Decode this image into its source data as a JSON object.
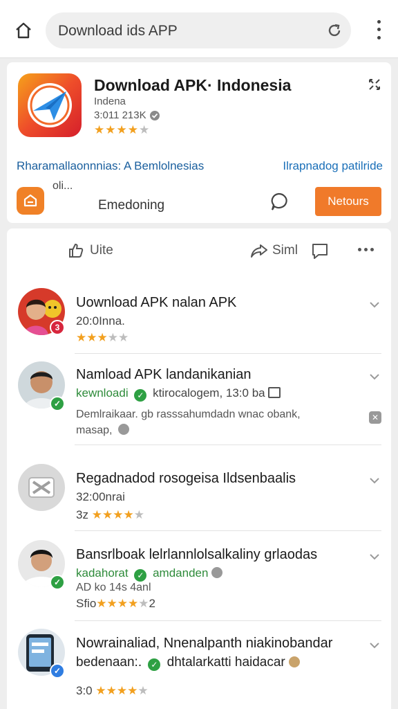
{
  "browser": {
    "url_text": "Download ids APP"
  },
  "app": {
    "title": "Download APK· Indonesia",
    "subtitle": "Indena",
    "meta": "3:011 213K",
    "rating": 4,
    "link_left": "Rharamallaonnnias: A Bemlolnesias",
    "link_right": "Ilrapnadog patilride",
    "small_text": "oli...",
    "action_text": "Emedoning",
    "install_label": "Netours"
  },
  "actions": {
    "like_label": "Uite",
    "share_label": "Siml"
  },
  "items": [
    {
      "title": "Uownload APK nalan APK",
      "line1": "20:0Inna.",
      "rating": 3
    },
    {
      "title": "Namload APK landanikanian",
      "line1_green": "kewnloadi",
      "line1_rest": "ktirocalogem, 13:0 ba",
      "line2": "Demlraikaar. gb rasssahumdadn wnac  obank,",
      "line3": "masap,"
    },
    {
      "title": "Regadnadod rosogeisa Ildsenbaalis",
      "line1": "32:00nrai",
      "line2_prefix": "3z",
      "rating": 4
    },
    {
      "title": "Bansrlboak lelrlannlolsalkaliny grlaodas",
      "line1_green": "kadahorat",
      "line1_rest": "amdanden",
      "line2": "AD ko 14s 4anl",
      "line3_prefix": "Sfio",
      "line3_suffix": "2",
      "rating": 4
    },
    {
      "title": "Nowrainaliad, Nnenalpanth niakinobandar",
      "line1": "bedenaan:.",
      "line1_rest": "dhtalarkatti haidacar",
      "line2_prefix": "3:0",
      "rating": 4
    }
  ],
  "colors": {
    "accent_orange": "#f07a2a",
    "link_blue": "#1a5f9e",
    "verified_green": "#2ea043",
    "star_gold": "#f2a01f"
  }
}
